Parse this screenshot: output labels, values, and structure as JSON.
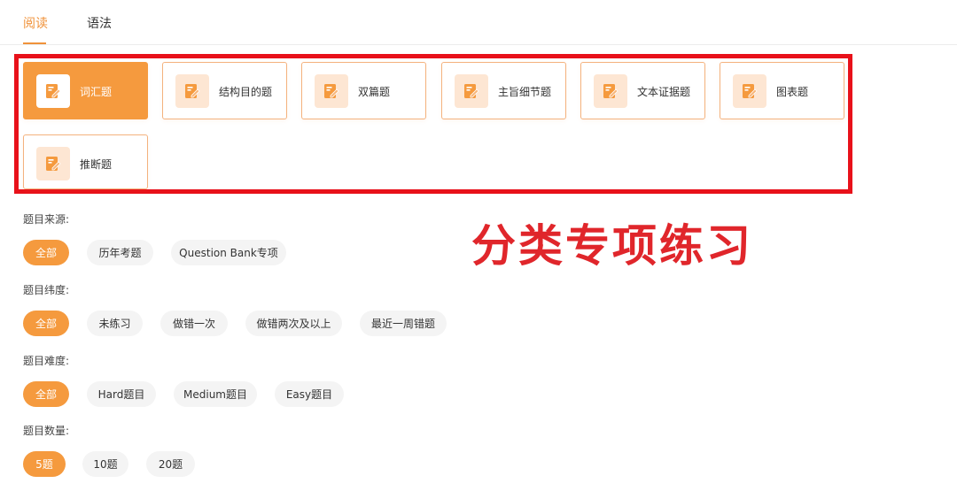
{
  "tabs": [
    {
      "label": "阅读",
      "active": true
    },
    {
      "label": "语法",
      "active": false
    }
  ],
  "categories": [
    {
      "label": "词汇题",
      "active": true,
      "icon": "edit-document-icon"
    },
    {
      "label": "结构目的题",
      "active": false,
      "icon": "edit-document-icon"
    },
    {
      "label": "双篇题",
      "active": false,
      "icon": "edit-document-icon"
    },
    {
      "label": "主旨细节题",
      "active": false,
      "icon": "edit-document-icon"
    },
    {
      "label": "文本证据题",
      "active": false,
      "icon": "edit-document-icon"
    },
    {
      "label": "图表题",
      "active": false,
      "icon": "edit-document-icon"
    },
    {
      "label": "推断题",
      "active": false,
      "icon": "edit-document-icon"
    }
  ],
  "annotation": "分类专项练习",
  "filters": {
    "source": {
      "label": "题目来源:",
      "options": [
        "全部",
        "历年考题",
        "Question Bank专项"
      ]
    },
    "dimension": {
      "label": "题目纬度:",
      "options": [
        "全部",
        "未练习",
        "做错一次",
        "做错两次及以上",
        "最近一周错题"
      ]
    },
    "difficulty": {
      "label": "题目难度:",
      "options": [
        "全部",
        "Hard题目",
        "Medium题目",
        "Easy题目"
      ]
    },
    "count": {
      "label": "题目数量:",
      "options": [
        "5题",
        "10题",
        "20题"
      ]
    }
  },
  "colors": {
    "accent": "#f59a3e",
    "annotation_red": "#e8111a",
    "chip_bg": "#f4f4f4"
  }
}
